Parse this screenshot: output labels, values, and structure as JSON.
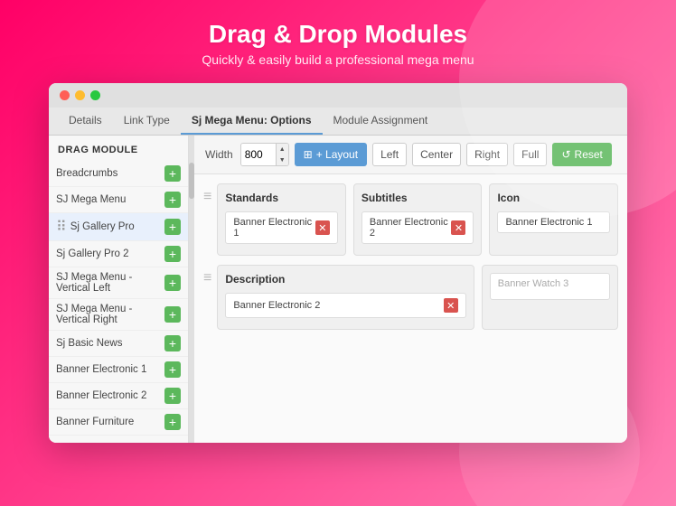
{
  "page": {
    "title": "Drag & Drop Modules",
    "subtitle": "Quickly & easily build a professional mega menu"
  },
  "window": {
    "tabs": [
      {
        "label": "Details",
        "active": false
      },
      {
        "label": "Link Type",
        "active": false
      },
      {
        "label": "Sj Mega Menu: Options",
        "active": true
      },
      {
        "label": "Module Assignment",
        "active": false
      }
    ]
  },
  "toolbar": {
    "width_label": "Width",
    "width_value": "800",
    "layout_label": "+ Layout",
    "left_label": "Left",
    "center_label": "Center",
    "right_label": "Right",
    "full_label": "Full",
    "reset_label": "↺ Reset"
  },
  "sidebar": {
    "title": "DRAG MODULE",
    "items": [
      {
        "label": "Breadcrumbs",
        "active": false
      },
      {
        "label": "SJ Mega Menu",
        "active": false
      },
      {
        "label": "Sj Gallery Pro",
        "active": true
      },
      {
        "label": "Sj Gallery Pro 2",
        "active": false
      },
      {
        "label": "SJ Mega Menu - Vertical Left",
        "active": false
      },
      {
        "label": "SJ Mega Menu - Vertical Right",
        "active": false
      },
      {
        "label": "Sj Basic News",
        "active": false
      },
      {
        "label": "Banner Electronic 1",
        "active": false
      },
      {
        "label": "Banner Electronic 2",
        "active": false
      },
      {
        "label": "Banner Furniture",
        "active": false
      }
    ]
  },
  "layout": {
    "rows": [
      {
        "columns": [
          {
            "title": "Standards",
            "items": [
              {
                "label": "Banner Electronic 1",
                "removable": true
              }
            ],
            "empty_slots": []
          },
          {
            "title": "Subtitles",
            "items": [
              {
                "label": "Banner Electronic 2",
                "removable": true
              }
            ],
            "empty_slots": []
          },
          {
            "title": "Icon",
            "items": [
              {
                "label": "Banner Electronic 1",
                "removable": false
              }
            ],
            "empty_slots": []
          }
        ]
      },
      {
        "columns": [
          {
            "title": "Description",
            "items": [
              {
                "label": "Banner Electronic 2",
                "removable": true
              }
            ],
            "empty_slots": [],
            "wide": true
          },
          {
            "title": "",
            "items": [],
            "empty_slots": [
              {
                "label": "Banner Watch 3"
              }
            ],
            "wide": false
          }
        ]
      }
    ]
  }
}
